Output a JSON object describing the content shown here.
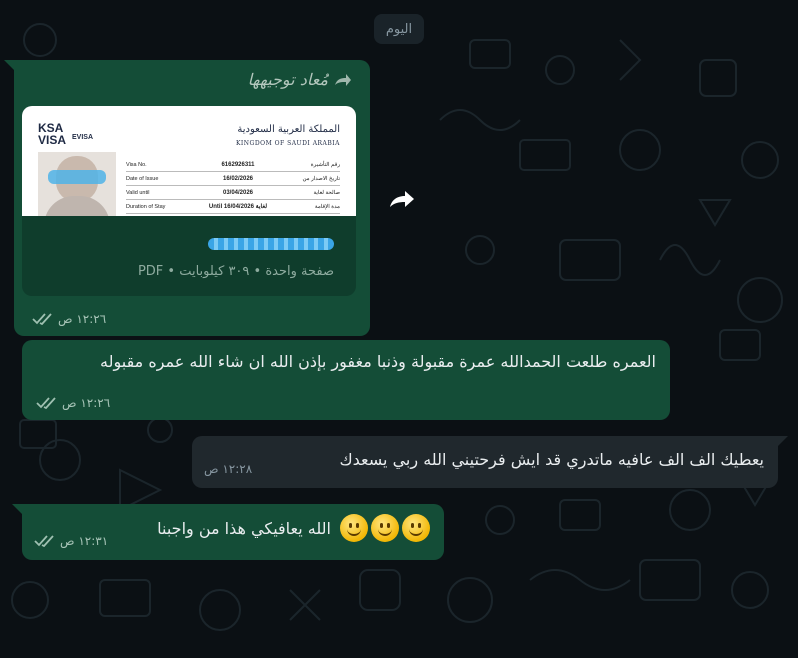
{
  "chat": {
    "day_label": "اليوم"
  },
  "messages": {
    "forwarded": {
      "forward_label": "مُعاد توجيهها",
      "doc_meta": "صفحة واحدة • ٣٠٩ كيلوبايت • PDF",
      "time": "١٢:٢٦ ص",
      "visa": {
        "brand_top": "KSA",
        "brand_bottom": "VISA",
        "evisa": "EVISA",
        "kingdom_ar": "المملكة العربية السعودية",
        "kingdom_en": "KINGDOM OF SAUDI ARABIA",
        "rows": [
          {
            "label_en": "Visa No.",
            "value": "6162926311",
            "label_ar": "رقم التأشيرة"
          },
          {
            "label_en": "Date of Issue",
            "value": "16/02/2026",
            "label_ar": "تاريخ الاصدار من"
          },
          {
            "label_en": "Valid until",
            "value": "03/04/2026",
            "label_ar": "صالحة لغاية"
          },
          {
            "label_en": "Duration of Stay",
            "value": "Until 16/04/2026 لغاية",
            "label_ar": "مدة الإقامة"
          }
        ]
      }
    },
    "m1": {
      "text": "العمره طلعت الحمدالله عمرة مقبولة وذنبا مغفور بإذن الله ان شاء الله عمره مقبوله",
      "time": "١٢:٢٦ ص"
    },
    "m2": {
      "text": "يعطيك الف الف عافيه ماتدري قد ايش فرحتيني الله ربي يسعدك",
      "time": "١٢:٢٨ ص"
    },
    "m3": {
      "text": "الله يعافيكي هذا من واجبنا",
      "time": "١٢:٣١ ص",
      "emoji": "slightly-smiling-face"
    }
  },
  "colors": {
    "background": "#0b1014",
    "outgoing_bubble": "#144d37",
    "incoming_bubble": "#20282d",
    "read_ticks": "#9fc0b1"
  }
}
